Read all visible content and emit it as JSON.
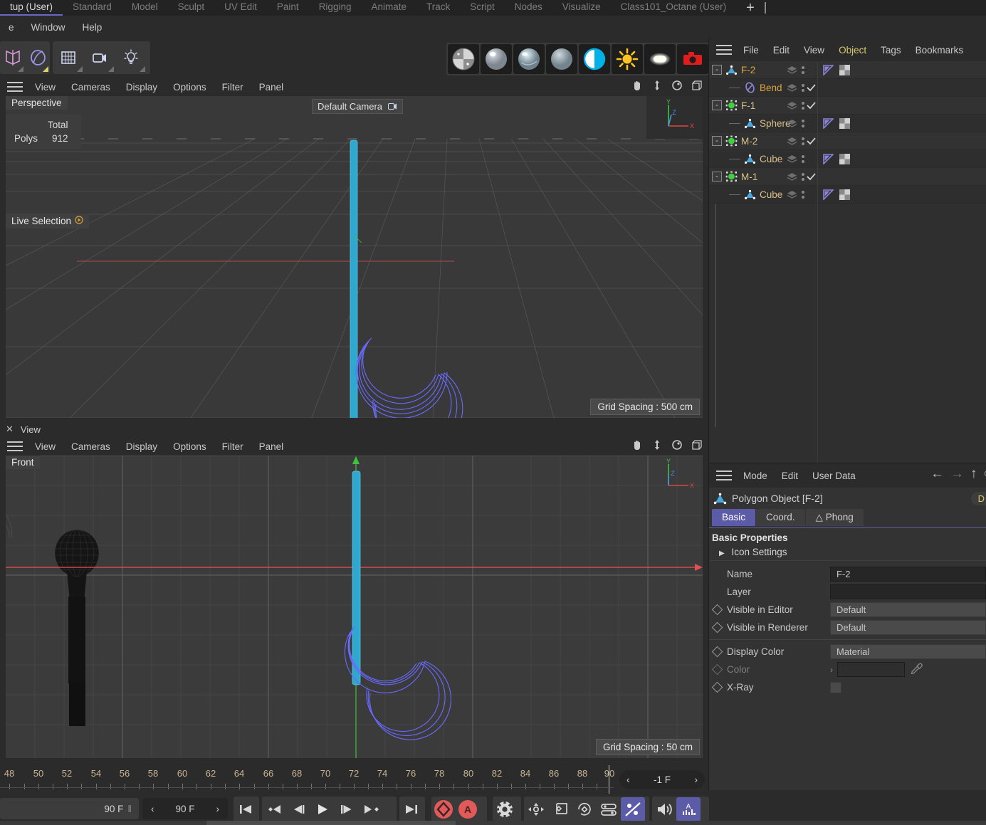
{
  "layout_tabs": [
    {
      "label": "tup (User)",
      "active": true
    },
    {
      "label": "Standard",
      "active": false
    },
    {
      "label": "Model",
      "active": false
    },
    {
      "label": "Sculpt",
      "active": false
    },
    {
      "label": "UV Edit",
      "active": false
    },
    {
      "label": "Paint",
      "active": false
    },
    {
      "label": "Rigging",
      "active": false
    },
    {
      "label": "Animate",
      "active": false
    },
    {
      "label": "Track",
      "active": false
    },
    {
      "label": "Script",
      "active": false
    },
    {
      "label": "Nodes",
      "active": false
    },
    {
      "label": "Visualize",
      "active": false
    },
    {
      "label": "Class101_Octane (User)",
      "active": false
    }
  ],
  "layout_add_label": "+",
  "menubar": [
    "e",
    "Window",
    "Help"
  ],
  "toolbar": {
    "group1": [
      "mirror-icon",
      "knife-icon"
    ],
    "group2": [
      "floor-icon",
      "camera-icon",
      "light-icon"
    ],
    "shaders": [
      "checker-material-icon",
      "glossy-material-icon",
      "glass-material-icon",
      "matte-material-icon",
      "contrast-icon",
      "sun-light-icon",
      "area-light-icon",
      "render-camera-icon"
    ]
  },
  "object_manager": {
    "menu": [
      "File",
      "Edit",
      "View",
      "Object",
      "Tags",
      "Bookmarks"
    ],
    "menu_highlight": "Object",
    "rows": [
      {
        "name": "F-2",
        "depth": 0,
        "icon": "polygon-object-icon",
        "color": "orange",
        "expander": "-",
        "check": false,
        "tags": [
          "phong-tag",
          "texture-tag"
        ]
      },
      {
        "name": "Bend",
        "depth": 1,
        "icon": "bend-deformer-icon",
        "color": "orange",
        "expander": "",
        "check": true,
        "tags": []
      },
      {
        "name": "F-1",
        "depth": 0,
        "icon": "null-object-icon",
        "color": "tan",
        "expander": "-",
        "check": true,
        "tags": []
      },
      {
        "name": "Sphere",
        "depth": 1,
        "icon": "polygon-object-icon",
        "color": "tan",
        "expander": "",
        "check": false,
        "tags": [
          "phong-tag",
          "texture-tag"
        ]
      },
      {
        "name": "M-2",
        "depth": 0,
        "icon": "null-object-icon",
        "color": "tan",
        "expander": "-",
        "check": true,
        "tags": []
      },
      {
        "name": "Cube",
        "depth": 1,
        "icon": "polygon-object-icon",
        "color": "tan",
        "expander": "",
        "check": false,
        "tags": [
          "phong-tag",
          "texture-tag"
        ]
      },
      {
        "name": "M-1",
        "depth": 0,
        "icon": "null-object-icon",
        "color": "tan",
        "expander": "-",
        "check": true,
        "tags": []
      },
      {
        "name": "Cube",
        "depth": 1,
        "icon": "polygon-object-icon",
        "color": "tan",
        "expander": "",
        "check": false,
        "tags": [
          "phong-tag",
          "texture-tag"
        ]
      }
    ]
  },
  "attribute_manager": {
    "menu": [
      "Mode",
      "Edit",
      "User Data"
    ],
    "nav_icons": [
      "back-arrow-icon",
      "forward-arrow-icon",
      "up-arrow-icon",
      "refresh-icon"
    ],
    "title": "Polygon Object [F-2]",
    "pin_label": "D",
    "tabs": [
      {
        "label": "Basic",
        "selected": true
      },
      {
        "label": "Coord.",
        "selected": false
      },
      {
        "label": "Phong",
        "selected": false,
        "icon": "phong-icon"
      }
    ],
    "section_title": "Basic Properties",
    "subsection": "Icon Settings",
    "fields": [
      {
        "label": "Name",
        "value": "F-2",
        "type": "text",
        "diamond": false,
        "dim": false
      },
      {
        "label": "Layer",
        "value": "",
        "type": "text",
        "diamond": false,
        "dim": false
      },
      {
        "label": "Visible in Editor",
        "value": "Default",
        "type": "select",
        "diamond": true,
        "dim": false
      },
      {
        "label": "Visible in Renderer",
        "value": "Default",
        "type": "select",
        "diamond": true,
        "dim": false
      },
      {
        "label": "Display Color",
        "value": "Material",
        "type": "select",
        "diamond": true,
        "dim": false
      },
      {
        "label": "Color",
        "value": "",
        "type": "color",
        "diamond": true,
        "dim": true
      },
      {
        "label": "X-Ray",
        "value": "",
        "type": "checkbox",
        "diamond": true,
        "dim": false
      }
    ]
  },
  "viewport1": {
    "menu": [
      "View",
      "Cameras",
      "Display",
      "Options",
      "Filter",
      "Panel"
    ],
    "nav_icons": [
      "pan-icon",
      "zoom-icon",
      "rotate-icon",
      "maximize-icon"
    ],
    "corner_label": "Perspective",
    "camera_label": "Default Camera",
    "stats": {
      "header": "Total",
      "row_label": "Polys",
      "row_value": "912"
    },
    "tool_label": "Live Selection",
    "grid_spacing": "Grid Spacing : 500 cm",
    "axis": {
      "x": "X",
      "y": "Y",
      "z": "Z"
    }
  },
  "viewport2": {
    "tab_label": "View",
    "close_label": "✕",
    "menu": [
      "View",
      "Cameras",
      "Display",
      "Options",
      "Filter",
      "Panel"
    ],
    "nav_icons": [
      "pan-icon",
      "zoom-icon",
      "rotate-icon",
      "maximize-icon"
    ],
    "corner_label": "Front",
    "grid_spacing": "Grid Spacing : 50 cm",
    "axis": {
      "x": "X",
      "y": "Y",
      "z": "Z"
    }
  },
  "timeline": {
    "ticks": [
      48,
      50,
      52,
      54,
      56,
      58,
      60,
      62,
      64,
      66,
      68,
      70,
      72,
      74,
      76,
      78,
      80,
      82,
      84,
      86,
      88,
      90
    ],
    "playhead_frame": 90,
    "frame_field": {
      "value": "-1 F",
      "prev": "‹",
      "next": "›"
    }
  },
  "transport": {
    "end_frame": "90 F",
    "current_frame": "90 F",
    "prev_arrow": "‹",
    "next_arrow": "›",
    "buttons": [
      "go-to-start-icon",
      "prev-key-icon",
      "prev-frame-icon",
      "play-icon",
      "next-frame-icon",
      "next-key-icon",
      "go-to-end-icon",
      "record-keyframe-icon",
      "autokey-icon",
      "keyframe-settings-icon",
      "record-position-icon",
      "record-scale-icon",
      "record-rotation-icon",
      "record-param-icon",
      "record-pla-icon",
      "sound-icon",
      "audio-track-icon"
    ],
    "autokey_letter": "A",
    "audio_letter": "A"
  },
  "colors": {
    "accent_purple": "#5c5ba8",
    "highlight_yellow": "#d8c86a",
    "object_orange": "#e0a43c",
    "spline_blue": "#6a6aff",
    "cyan_object": "#2fa8cf",
    "record_red": "#e05050",
    "axis_x": "#e04545",
    "axis_y": "#3fc43f",
    "axis_z": "#4a8fe0"
  }
}
